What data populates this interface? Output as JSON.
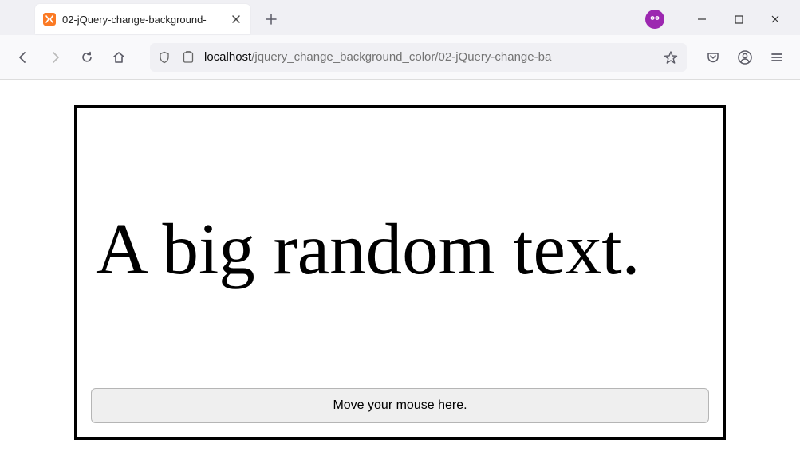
{
  "browser": {
    "tab": {
      "title": "02-jQuery-change-background-",
      "favicon": "xampp-icon"
    },
    "url": {
      "host": "localhost",
      "path": "/jquery_change_background_color/02-jQuery-change-ba"
    }
  },
  "page": {
    "heading": "A big random text.",
    "button_label": "Move your mouse here."
  }
}
